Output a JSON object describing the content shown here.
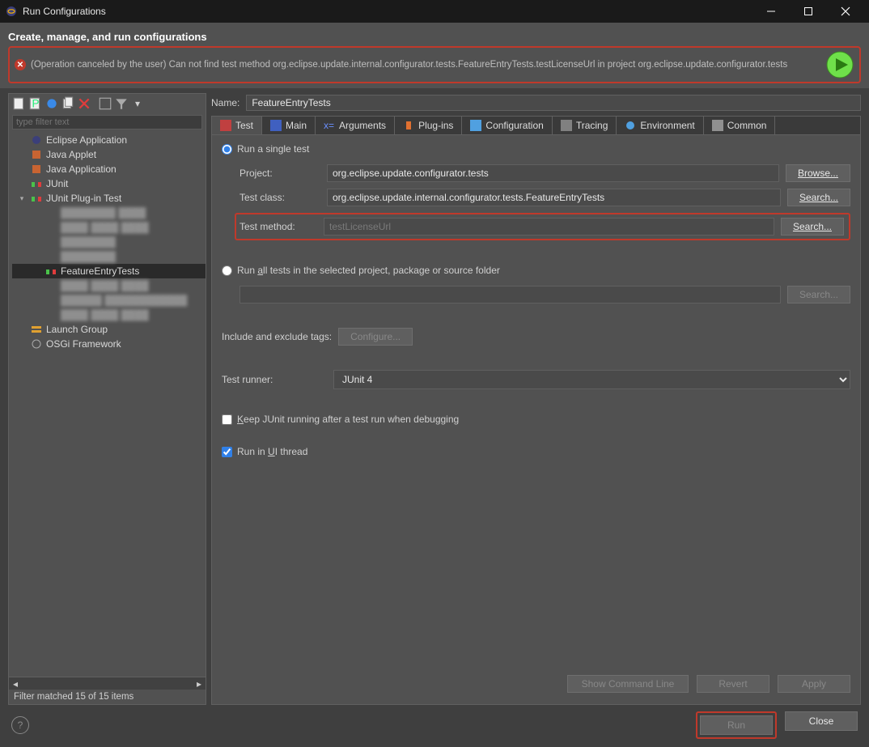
{
  "titlebar": {
    "title": "Run Configurations"
  },
  "header": {
    "subtitle": "Create, manage, and run configurations",
    "error_message": "(Operation canceled by the user) Can not find test method org.eclipse.update.internal.configurator.tests.FeatureEntryTests.testLicenseUrl in project org.eclipse.update.configurator.tests"
  },
  "left": {
    "filter_placeholder": "type filter text",
    "tree": {
      "items": [
        {
          "label": "Eclipse Application",
          "icon": "eclipse"
        },
        {
          "label": "Java Applet",
          "icon": "java"
        },
        {
          "label": "Java Application",
          "icon": "java"
        },
        {
          "label": "JUnit",
          "icon": "junit"
        },
        {
          "label": "JUnit Plug-in Test",
          "icon": "junit",
          "expanded": true
        },
        {
          "label": "blurred-item-1",
          "blur": true,
          "depth": 2
        },
        {
          "label": "blurred-item-2",
          "blur": true,
          "depth": 2
        },
        {
          "label": "blurred-item-3",
          "blur": true,
          "depth": 2
        },
        {
          "label": "blurred-item-4",
          "blur": true,
          "depth": 2
        },
        {
          "label": "FeatureEntryTests",
          "depth": 2,
          "selected": true,
          "icon": "junit"
        },
        {
          "label": "blurred-item-5",
          "blur": true,
          "depth": 2
        },
        {
          "label": "blurred-item-6",
          "blur": true,
          "depth": 2
        },
        {
          "label": "blurred-item-7",
          "blur": true,
          "depth": 2
        },
        {
          "label": "Launch Group",
          "icon": "launchgroup"
        },
        {
          "label": "OSGi Framework",
          "icon": "osgi"
        }
      ]
    },
    "status": "Filter matched 15 of 15 items"
  },
  "right": {
    "name_label": "Name:",
    "name_value": "FeatureEntryTests",
    "tabs": [
      "Test",
      "Main",
      "Arguments",
      "Plug-ins",
      "Configuration",
      "Tracing",
      "Environment",
      "Common"
    ],
    "test_tab": {
      "run_single_label": "Run a single test",
      "project_label": "Project:",
      "project_value": "org.eclipse.update.configurator.tests",
      "project_btn": "Browse...",
      "class_label": "Test class:",
      "class_value": "org.eclipse.update.internal.configurator.tests.FeatureEntryTests",
      "class_btn": "Search...",
      "method_label": "Test method:",
      "method_value": "testLicenseUrl",
      "method_btn": "Search...",
      "run_all_label": "Run all tests in the selected project, package or source folder",
      "run_all_btn": "Search...",
      "tags_label": "Include and exclude tags:",
      "tags_btn": "Configure...",
      "runner_label": "Test runner:",
      "runner_value": "JUnit 4",
      "keep_running_label": "Keep JUnit running after a test run when debugging",
      "ui_thread_label": "Run in UI thread"
    },
    "actions": {
      "show_cmd": "Show Command Line",
      "revert": "Revert",
      "apply": "Apply"
    }
  },
  "footer": {
    "run": "Run",
    "close": "Close"
  }
}
